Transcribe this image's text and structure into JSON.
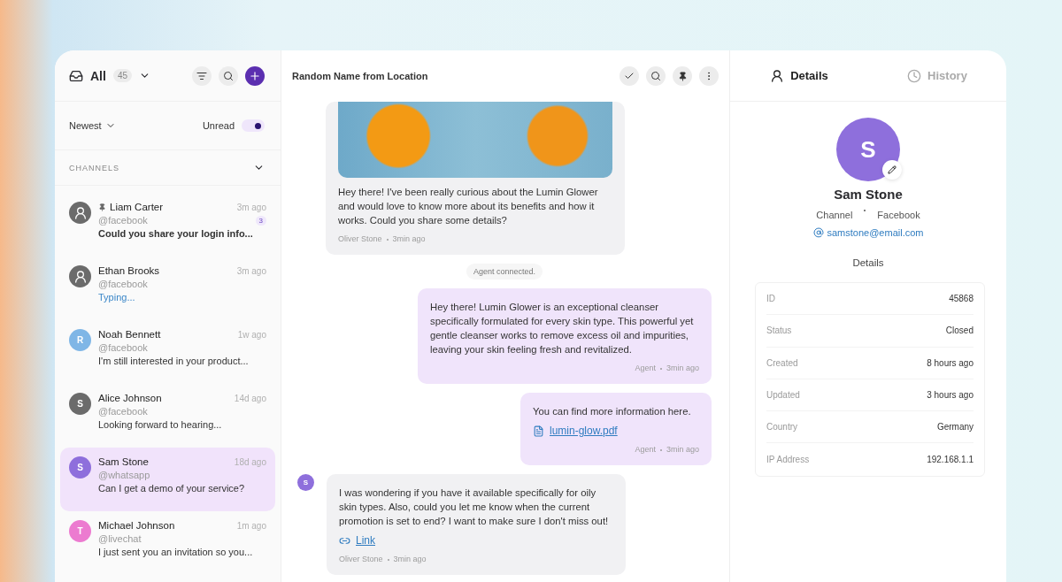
{
  "inbox": {
    "title": "All",
    "count": "45",
    "sort": "Newest",
    "unread_filter": {
      "label": "Unread",
      "on": true
    },
    "section": "CHANNELS"
  },
  "conversations": [
    {
      "name": "Liam Carter",
      "handle": "@facebook",
      "time": "3m ago",
      "preview": "Could you share your login info...",
      "kind": "unread",
      "pinned": true,
      "unread_count": "3",
      "avatar": {
        "kind": "icon"
      },
      "selected": false
    },
    {
      "name": "Ethan Brooks",
      "handle": "@facebook",
      "time": "3m ago",
      "preview": "Typing...",
      "kind": "typing",
      "pinned": false,
      "avatar": {
        "kind": "icon"
      },
      "selected": false
    },
    {
      "name": "Noah Bennett",
      "handle": "@facebook",
      "time": "1w ago",
      "preview": "I'm still interested in your product...",
      "kind": "normal",
      "pinned": false,
      "avatar": {
        "kind": "letter",
        "letter": "R",
        "color": "#7fb6e6"
      },
      "selected": false
    },
    {
      "name": "Alice Johnson",
      "handle": "@facebook",
      "time": "14d ago",
      "preview": "Looking forward to hearing...",
      "kind": "normal",
      "pinned": false,
      "avatar": {
        "kind": "letter",
        "letter": "S",
        "color": "#6b6b6b"
      },
      "selected": false
    },
    {
      "name": "Sam Stone",
      "handle": "@whatsapp",
      "time": "18d ago",
      "preview": "Can I get a demo of your service?",
      "kind": "normal",
      "pinned": false,
      "avatar": {
        "kind": "letter",
        "letter": "S",
        "color": "#8e6fdc"
      },
      "selected": true
    },
    {
      "name": "Michael Johnson",
      "handle": "@livechat",
      "time": "1m ago",
      "preview": "I just sent you an invitation so you...",
      "kind": "normal",
      "pinned": false,
      "avatar": {
        "kind": "letter",
        "letter": "T",
        "color": "#ec7bd0"
      },
      "selected": false
    }
  ],
  "chat": {
    "title": "Random Name from Location",
    "messages": [
      {
        "kind": "incoming_image",
        "text": "Hey there! I've been really curious about the Lumin Glower and would love to know more about its benefits and how it works. Could you share some details?",
        "author": "Oliver Stone",
        "time": "3min ago"
      },
      {
        "kind": "system",
        "text": "Agent connected."
      },
      {
        "kind": "outgoing",
        "text": "Hey there! Lumin Glower is an exceptional cleanser specifically formulated for every skin type. This powerful yet gentle cleanser works to remove excess oil and impurities, leaving your skin feeling fresh and revitalized.",
        "author": "Agent",
        "time": "3min ago"
      },
      {
        "kind": "outgoing",
        "text": "You can find more information here.",
        "attachment": "lumin-glow.pdf",
        "author": "Agent",
        "time": "3min ago"
      },
      {
        "kind": "incoming",
        "avatar": {
          "letter": "S",
          "color": "#8e6fdc"
        },
        "text": "I was wondering if you have it available specifically for oily skin types. Also, could you let me know when the current promotion is set to end? I want to make sure I don't miss out!",
        "link": "Link",
        "author": "Oliver Stone",
        "time": "3min ago"
      }
    ]
  },
  "details_panel": {
    "tabs": [
      {
        "label": "Details",
        "kind": "person",
        "selected": true
      },
      {
        "label": "History",
        "kind": "clock",
        "selected": false
      }
    ],
    "contact": {
      "letter": "S",
      "name": "Sam Stone",
      "channel_label": "Channel",
      "channel": "Facebook",
      "email": "samstone@email.com"
    },
    "section": "Details",
    "fields": [
      {
        "label": "ID",
        "value": "45868"
      },
      {
        "label": "Status",
        "value": "Closed"
      },
      {
        "label": "Created",
        "value": "8 hours ago"
      },
      {
        "label": "Updated",
        "value": "3 hours ago"
      },
      {
        "label": "Country",
        "value": "Germany"
      },
      {
        "label": "IP Address",
        "value": "192.168.1.1"
      }
    ]
  }
}
